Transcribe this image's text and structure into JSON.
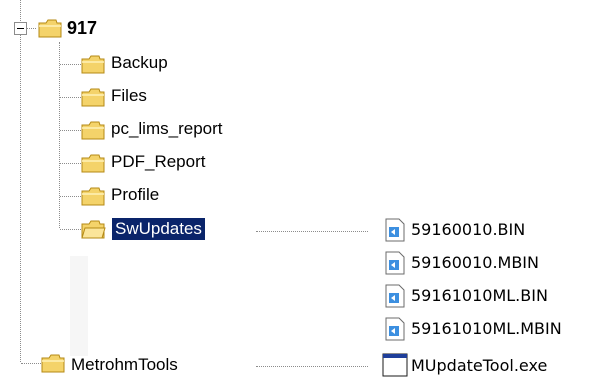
{
  "tree": {
    "root": {
      "label": "917",
      "expanded": true,
      "icon": "folder-icon"
    },
    "children": [
      {
        "label": "Backup",
        "icon": "folder-icon"
      },
      {
        "label": "Files",
        "icon": "folder-icon"
      },
      {
        "label": "pc_lims_report",
        "icon": "folder-icon"
      },
      {
        "label": "PDF_Report",
        "icon": "folder-icon"
      },
      {
        "label": "Profile",
        "icon": "folder-icon"
      },
      {
        "label": "SwUpdates",
        "icon": "folder-icon",
        "selected": true
      }
    ],
    "sibling": {
      "label": "MetrohmTools",
      "icon": "folder-icon"
    }
  },
  "files": {
    "swupdates": [
      {
        "name": "59160010.BIN",
        "icon": "bin-file-icon"
      },
      {
        "name": "59160010.MBIN",
        "icon": "bin-file-icon"
      },
      {
        "name": "59161010ML.BIN",
        "icon": "bin-file-icon"
      },
      {
        "name": "59161010ML.MBIN",
        "icon": "bin-file-icon"
      }
    ],
    "metrohmtools": [
      {
        "name": "MUpdateTool.exe",
        "icon": "exe-file-icon"
      }
    ]
  },
  "colors": {
    "selection": "#0a246a",
    "folder_fill": "#f4d36a",
    "folder_stroke": "#b58a14",
    "tree_lines": "#8c8c8c"
  }
}
